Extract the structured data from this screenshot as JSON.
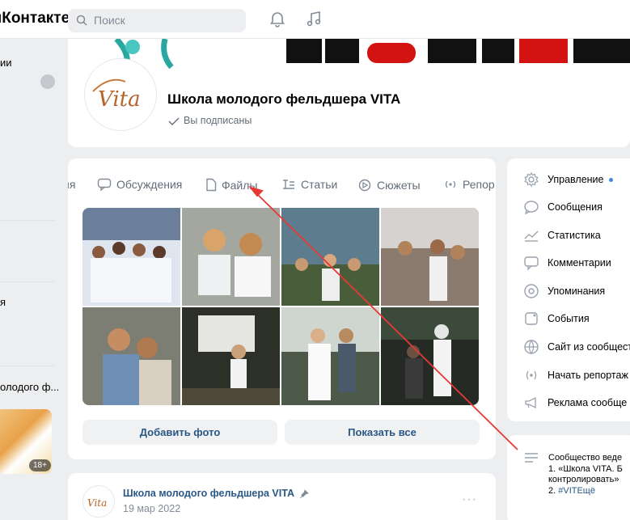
{
  "topbar": {
    "brand": "ыКонтакте",
    "search_placeholder": "Поиск"
  },
  "left": {
    "item1": "ии",
    "item2": "я",
    "item3": "олодого ф...",
    "badge": "18+"
  },
  "group": {
    "title": "Школа молодого фельдшера VITA",
    "subscribed": "Вы подписаны",
    "avatar_text": "Vita"
  },
  "tabs": [
    {
      "label": "ия"
    },
    {
      "label": "Обсуждения"
    },
    {
      "label": "Файлы"
    },
    {
      "label": "Статьи"
    },
    {
      "label": "Сюжеты"
    },
    {
      "label": "Репор"
    }
  ],
  "photos_actions": {
    "add": "Добавить фото",
    "show_all": "Показать все"
  },
  "post": {
    "author": "Школа молодого фельдшера VITA",
    "date": "19 мар 2022",
    "more": "···"
  },
  "menu": [
    {
      "label": "Управление",
      "icon": "gear-icon"
    },
    {
      "label": "Сообщения",
      "icon": "message-icon"
    },
    {
      "label": "Статистика",
      "icon": "chart-icon"
    },
    {
      "label": "Комментарии",
      "icon": "comment-icon"
    },
    {
      "label": "Упоминания",
      "icon": "at-icon"
    },
    {
      "label": "События",
      "icon": "event-icon"
    },
    {
      "label": "Сайт из сообщест",
      "icon": "globe-icon"
    },
    {
      "label": "Начать репортаж",
      "icon": "broadcast-icon"
    },
    {
      "label": "Реклама сообще",
      "icon": "megaphone-icon"
    }
  ],
  "description": {
    "line1": "Сообщество веде",
    "line2": "1. «Школа VITA. Б",
    "line3": "контролировать»",
    "line4_prefix": "2. ",
    "line4_link": "#VITEщё"
  },
  "colors": {
    "accent": "#2a5885",
    "dot": "#3f8ae0",
    "arrow": "#e53935"
  }
}
